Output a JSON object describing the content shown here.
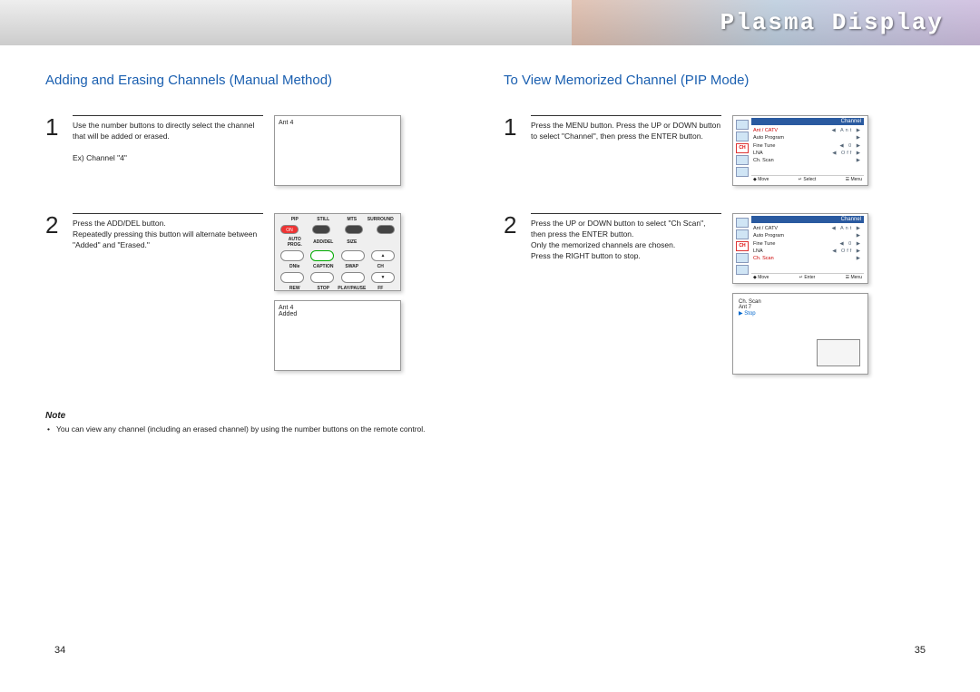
{
  "header": {
    "title": "Plasma Display"
  },
  "left": {
    "title": "Adding and Erasing Channels (Manual Method)",
    "step1": {
      "num": "1",
      "text": "Use the number buttons to directly select the channel that will be added or erased.",
      "sub": "Ex) Channel \"4\"",
      "screen": "Ant 4"
    },
    "step2": {
      "num": "2",
      "text": "Press the ADD/DEL button.\nRepeatedly pressing this button will alternate between \"Added\" and \"Erased.\"",
      "screen1": "Ant 4",
      "screen2": "Added"
    },
    "note_title": "Note",
    "note_text": "You can view any channel (including an erased channel) by using the number buttons on the remote control.",
    "page": "34"
  },
  "right": {
    "title": "To View Memorized Channel (PIP Mode)",
    "step1": {
      "num": "1",
      "text": "Press the MENU button. Press the UP or DOWN button to select \"Channel\", then press the ENTER button."
    },
    "step2": {
      "num": "2",
      "text": "Press the UP or DOWN button to select \"Ch Scan\", then press the ENTER button.\nOnly the memorized channels are chosen.\nPress the RIGHT button to stop."
    },
    "page": "35"
  },
  "osd": {
    "title": "Channel",
    "rows": [
      {
        "label": "Ant / CATV",
        "value": "Ant"
      },
      {
        "label": "Auto Program",
        "value": ""
      },
      {
        "label": "Fine Tune",
        "value": "0"
      },
      {
        "label": "LNA",
        "value": "Off"
      },
      {
        "label": "Ch. Scan",
        "value": ""
      }
    ],
    "footer1": [
      "◆ Move",
      "↵ Select",
      "☰ Menu"
    ],
    "footer2": [
      "◆ Move",
      "↵ Enter",
      "☰ Menu"
    ],
    "ch_icon": "CH"
  },
  "scan": {
    "title": "Ch. Scan",
    "ant": "Ant 7",
    "stop": "▶ Stop"
  },
  "remote": {
    "row1": [
      "PIP",
      "STILL",
      "MTS",
      "SURROUND"
    ],
    "row1b": [
      "ON",
      "",
      "",
      ""
    ],
    "row2": [
      "AUTO PROG.",
      "ADD/DEL",
      "SIZE",
      ""
    ],
    "row3": [
      "DNIe",
      "CAPTION",
      "SWAP",
      "CH"
    ],
    "row4": [
      "REW",
      "STOP",
      "PLAY/PAUSE",
      "FF"
    ]
  }
}
